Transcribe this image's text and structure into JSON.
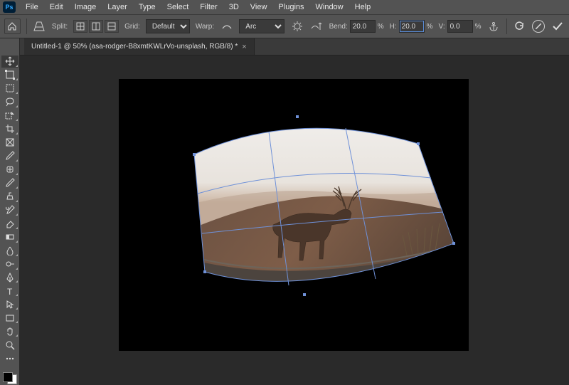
{
  "menu": [
    "File",
    "Edit",
    "Image",
    "Layer",
    "Type",
    "Select",
    "Filter",
    "3D",
    "View",
    "Plugins",
    "Window",
    "Help"
  ],
  "optbar": {
    "split_label": "Split:",
    "grid_label": "Grid:",
    "grid_value": "Default",
    "warp_label": "Warp:",
    "warp_value": "Arc",
    "bend_label": "Bend:",
    "bend_value": "20.0",
    "h_label": "H:",
    "h_value": "20.0",
    "v_label": "V:",
    "v_value": "0.0",
    "percent": "%"
  },
  "tab": {
    "title": "Untitled-1 @ 50% (asa-rodger-B8xmtKWLrVo-unsplash, RGB/8) *"
  },
  "tools": [
    "move",
    "artboard",
    "marquee",
    "lasso",
    "quick-select",
    "crop",
    "frame",
    "eyedropper",
    "healing",
    "brush",
    "clone-stamp",
    "history-brush",
    "eraser",
    "gradient",
    "blur",
    "dodge",
    "pen",
    "type",
    "path-select",
    "rectangle",
    "hand",
    "zoom",
    "edit-toolbar"
  ],
  "swatch": {
    "fg": "#000000",
    "bg": "#ffffff"
  }
}
